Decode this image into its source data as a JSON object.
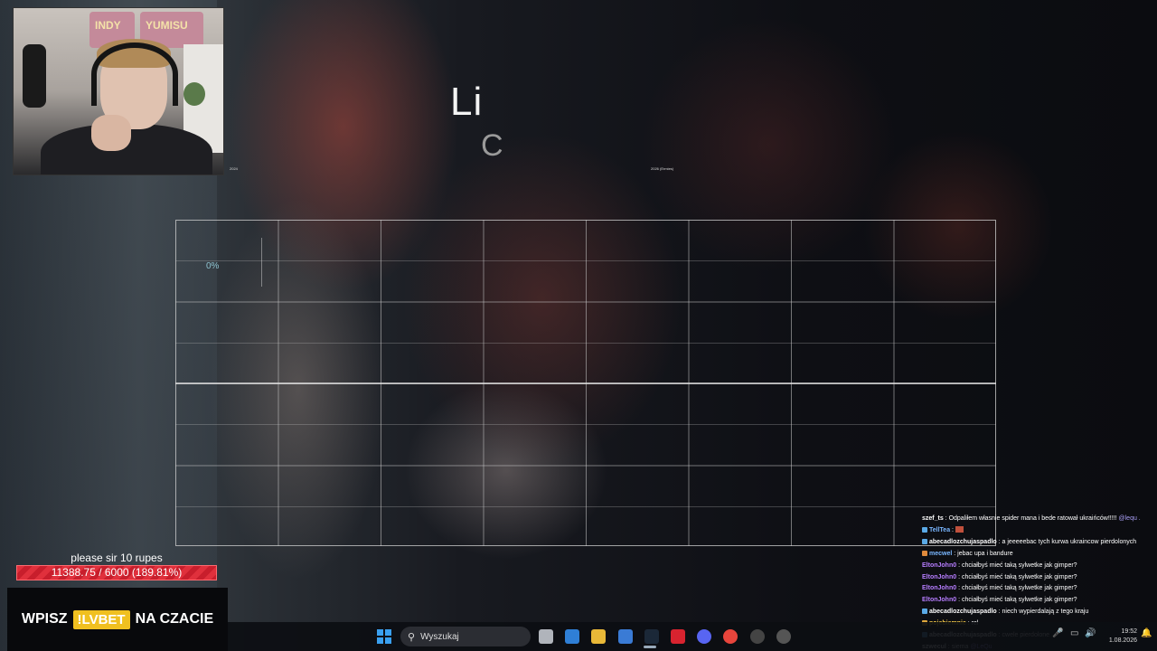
{
  "webcam": {
    "banner_left": "INDY",
    "banner_right": "YUMISU",
    "tag_left": "2024",
    "tag_right": "2026 (Ermies)"
  },
  "stage": {
    "title": "Li",
    "subtitle": "C",
    "percent_label": "0%"
  },
  "goal": {
    "title": "please sir 10 rupes",
    "progress_text": "11388.75 / 6000 (189.81%)",
    "progress_fraction": 1.0,
    "bar_color": "#e0303c"
  },
  "promo": {
    "before": "WPISZ",
    "code": "!LVBET",
    "after": "NA CZACIE",
    "code_color": "#f0c020"
  },
  "chat": [
    {
      "user": "szef_ts",
      "user_color": "#ffffff",
      "badge_color": "",
      "message": "Odpaliłem własnie spider mana i bede ratował ukraińców!!!!! ",
      "mention": "@lequ ."
    },
    {
      "user": "TellTea",
      "user_color": "#7ab7ff",
      "badge_color": "#5aa9e6",
      "message": "",
      "mention": "",
      "emote": true
    },
    {
      "user": "abecadlozchujaspadlo",
      "user_color": "#ffffff",
      "badge_color": "#5aa9e6",
      "message": "a jeeeeebac tych kurwa ukraincow pierdolonych",
      "mention": ""
    },
    {
      "user": "mecwel",
      "user_color": "#7ab7ff",
      "badge_color": "#e08a3c",
      "message": "jebac upa i bandure",
      "mention": ""
    },
    {
      "user": "EltonJohn0",
      "user_color": "#b77dff",
      "badge_color": "",
      "message": "chciałbyś mieć taką sylwetke jak gimper?",
      "mention": ""
    },
    {
      "user": "EltonJohn0",
      "user_color": "#b77dff",
      "badge_color": "",
      "message": "chciałbyś mieć taką sylwetke jak gimper?",
      "mention": ""
    },
    {
      "user": "EltonJohn0",
      "user_color": "#b77dff",
      "badge_color": "",
      "message": "chciałbyś mieć taką sylwetke jak gimper?",
      "mention": ""
    },
    {
      "user": "EltonJohn0",
      "user_color": "#b77dff",
      "badge_color": "",
      "message": "chciałbyś mieć taką sylwetke jak gimper?",
      "mention": ""
    },
    {
      "user": "abecadlozchujaspadlo",
      "user_color": "#ffffff",
      "badge_color": "#5aa9e6",
      "message": "niech wypierdalają z tego kraju",
      "mention": ""
    },
    {
      "user": "pojebiemnie",
      "user_color": "#ffd24a",
      "badge_color": "#e0a83c",
      "message": "rel",
      "mention": ""
    },
    {
      "user": "abecadlozchujaspadlo",
      "user_color": "#ffffff",
      "badge_color": "#5aa9e6",
      "message": "cwele pierdolone",
      "mention": ""
    },
    {
      "user": "szwecul",
      "user_color": "#ffffff",
      "badge_color": "",
      "message": "siema ",
      "mention": "@LeQu"
    }
  ],
  "taskbar": {
    "search_placeholder": "Wyszukaj",
    "time": "19:52",
    "date": "1.08.2026",
    "icons": [
      "task-view-icon",
      "mail-icon",
      "file-explorer-icon",
      "store-icon",
      "steam-icon",
      "app-red-icon",
      "discord-icon",
      "chrome-icon",
      "obs-icon",
      "obs-alt-icon"
    ],
    "icon_colors": [
      "#b0b4bb",
      "#2f7fd6",
      "#e8b838",
      "#3a7bd5",
      "#1b2838",
      "#d8232f",
      "#5865f2",
      "#e8453c",
      "#444444",
      "#555555"
    ]
  }
}
